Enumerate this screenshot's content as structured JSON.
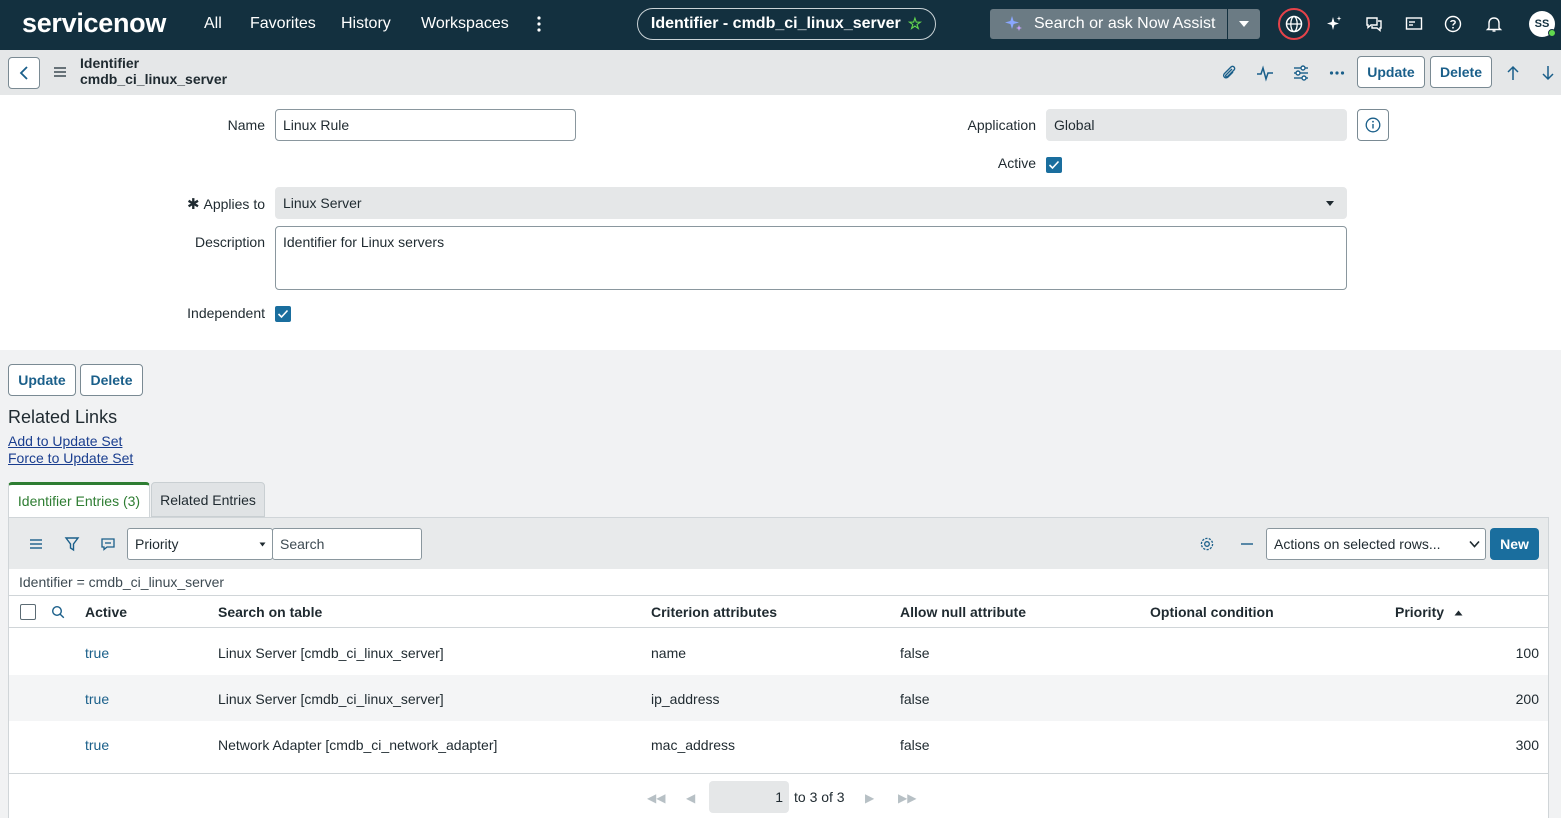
{
  "nav": {
    "logo": "servicenow",
    "links": [
      "All",
      "Favorites",
      "History",
      "Workspaces"
    ],
    "title_pill": "Identifier - cmdb_ci_linux_server",
    "search_placeholder": "Search or ask Now Assist",
    "avatar_initials": "SS",
    "accent_color": "#62d84e",
    "bg_color": "#13303f"
  },
  "header": {
    "line1": "Identifier",
    "line2": "cmdb_ci_linux_server",
    "update_label": "Update",
    "delete_label": "Delete"
  },
  "form": {
    "name_label": "Name",
    "name_value": "Linux Rule",
    "application_label": "Application",
    "application_value": "Global",
    "active_label": "Active",
    "active_checked": true,
    "applies_to_label": "Applies to",
    "applies_to_value": "Linux Server",
    "description_label": "Description",
    "description_value": "Identifier for Linux servers",
    "independent_label": "Independent",
    "independent_checked": true
  },
  "bottom_buttons": {
    "update": "Update",
    "delete": "Delete"
  },
  "related_links": {
    "title": "Related Links",
    "links": [
      "Add to Update Set",
      "Force to Update Set"
    ]
  },
  "tabs": [
    "Identifier Entries (3)",
    "Related Entries"
  ],
  "list": {
    "filter_field": "Priority",
    "search_placeholder": "Search",
    "actions_label": "Actions on selected rows...",
    "new_label": "New",
    "breadcrumb": "Identifier = cmdb_ci_linux_server",
    "columns": [
      "Active",
      "Search on table",
      "Criterion attributes",
      "Allow null attribute",
      "Optional condition",
      "Priority"
    ],
    "rows": [
      {
        "active": "true",
        "table": "Linux Server [cmdb_ci_linux_server]",
        "criterion": "name",
        "allow_null": "false",
        "condition": "",
        "priority": "100"
      },
      {
        "active": "true",
        "table": "Linux Server [cmdb_ci_linux_server]",
        "criterion": "ip_address",
        "allow_null": "false",
        "condition": "",
        "priority": "200"
      },
      {
        "active": "true",
        "table": "Network Adapter [cmdb_ci_network_adapter]",
        "criterion": "mac_address",
        "allow_null": "false",
        "condition": "",
        "priority": "300"
      }
    ],
    "pager": {
      "page": "1",
      "range_text": "to 3 of 3"
    }
  }
}
